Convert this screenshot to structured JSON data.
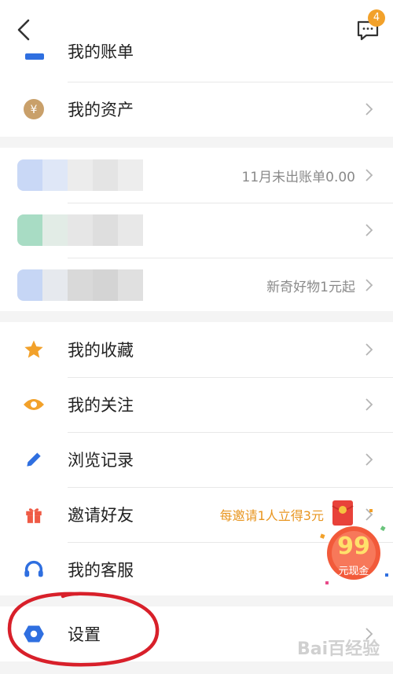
{
  "header": {
    "badge_count": "4"
  },
  "account_group": {
    "partial_label": "我的账单",
    "assets_label": "我的资产"
  },
  "services": {
    "row1_right": "11月未出账单0.00",
    "row2_right": "",
    "row3_right": "新奇好物1元起"
  },
  "menu": {
    "favorites": "我的收藏",
    "follows": "我的关注",
    "history": "浏览记录",
    "invite": "邀请好友",
    "invite_promo": "每邀请1人立得3元",
    "service": "我的客服"
  },
  "promo": {
    "amount": "99",
    "caption": "元现金"
  },
  "settings": {
    "label": "设置"
  },
  "watermark": "Bai百经验",
  "colors": {
    "accent_orange": "#f2a12a",
    "blue": "#2f6fe0",
    "red": "#ef5a45",
    "annotation_red": "#d8202a"
  }
}
